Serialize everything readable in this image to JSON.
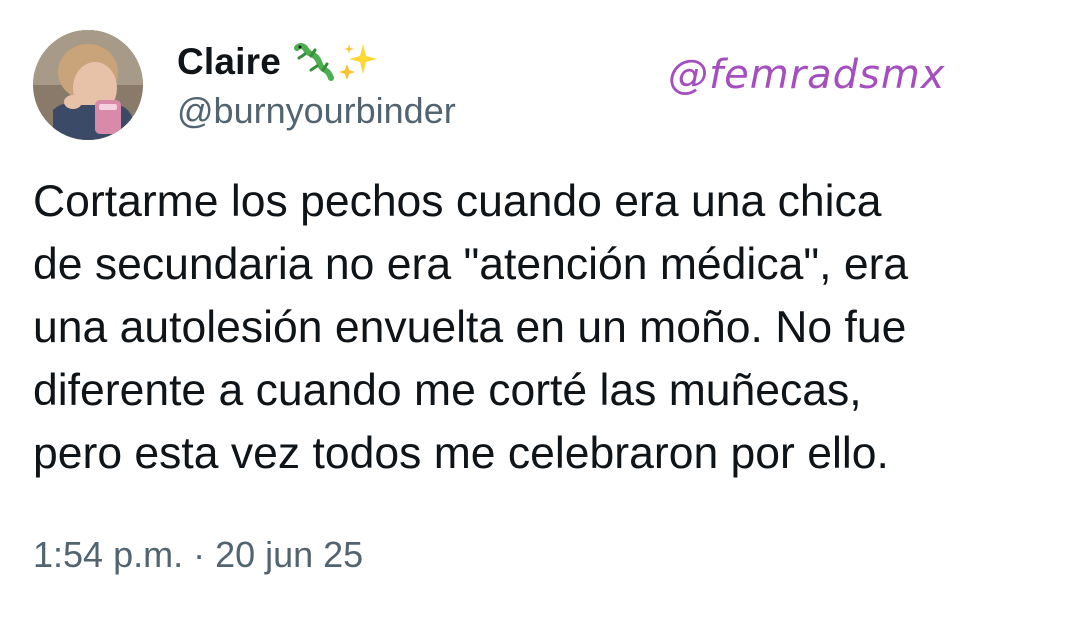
{
  "tweet": {
    "author": {
      "display_name": "Claire",
      "name_emojis": [
        "lizard-emoji",
        "sparkles-emoji"
      ],
      "handle": "@burnyourbinder",
      "avatar": "profile-photo"
    },
    "text_lines": [
      "Cortarme los pechos cuando era una chica",
      "de secundaria no era \"atención médica\", era",
      "una autolesión envuelta en un moño. No fue",
      "diferente a cuando me corté las muñecas,",
      "pero esta vez todos me celebraron por ello."
    ],
    "timestamp": "1:54 p.m. · 20 jun 25"
  },
  "watermark": {
    "text": "@femradsmx",
    "color": "#a44ebf"
  },
  "colors": {
    "text": "#0f1419",
    "secondary": "#536471",
    "background": "#ffffff"
  }
}
